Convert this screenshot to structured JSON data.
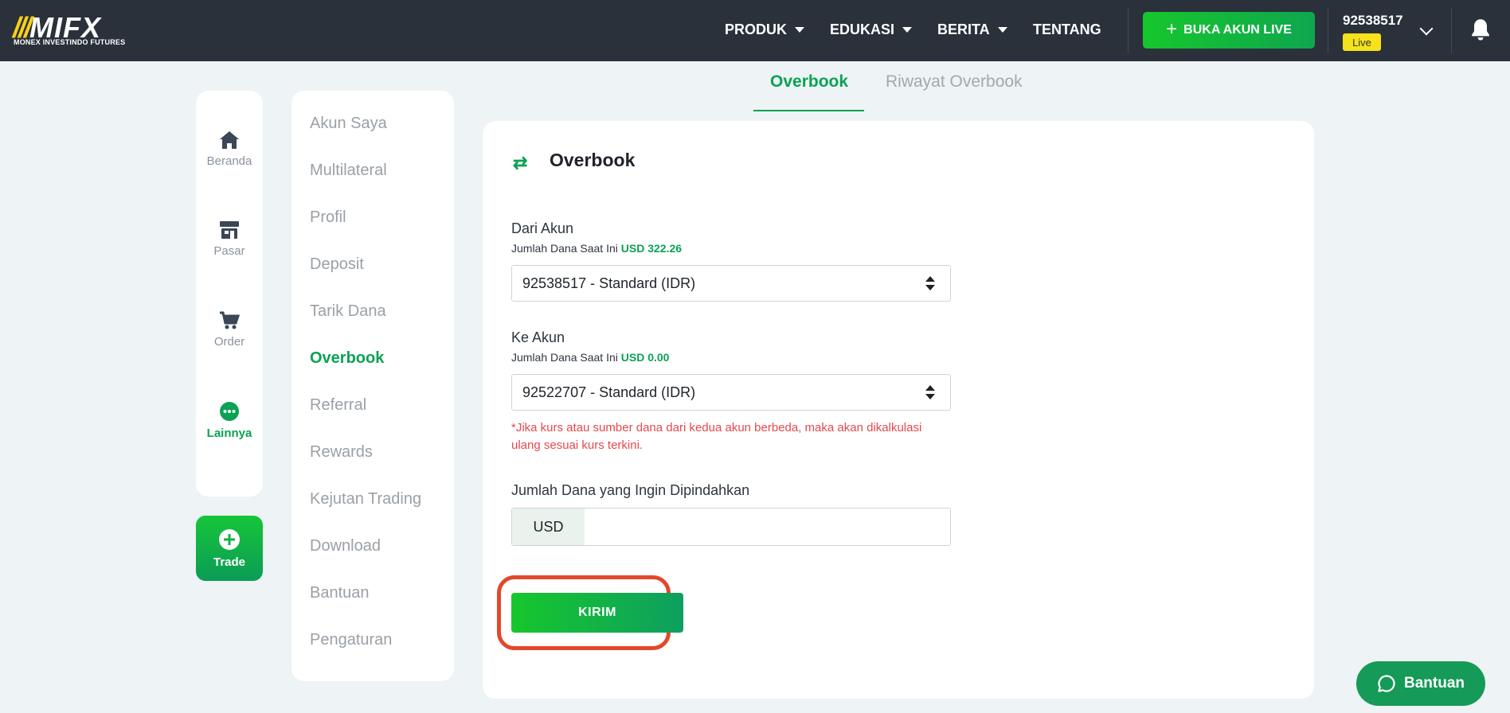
{
  "brand": {
    "logo_text": "MIFX",
    "tagline": "MONEX INVESTINDO FUTURES"
  },
  "nav": {
    "items": [
      {
        "label": "PRODUK",
        "has_dropdown": true
      },
      {
        "label": "EDUKASI",
        "has_dropdown": true
      },
      {
        "label": "BERITA",
        "has_dropdown": true
      },
      {
        "label": "TENTANG",
        "has_dropdown": false
      }
    ],
    "open_live_label": "BUKA AKUN LIVE",
    "account_number": "92538517",
    "account_badge": "Live"
  },
  "icon_sidebar": {
    "items": [
      {
        "label": "Beranda",
        "icon": "home-icon"
      },
      {
        "label": "Pasar",
        "icon": "store-icon"
      },
      {
        "label": "Order",
        "icon": "cart-icon"
      },
      {
        "label": "Lainnya",
        "icon": "more-icon",
        "active": true
      }
    ],
    "trade_label": "Trade"
  },
  "menu": {
    "items": [
      {
        "label": "Akun Saya"
      },
      {
        "label": "Multilateral"
      },
      {
        "label": "Profil"
      },
      {
        "label": "Deposit"
      },
      {
        "label": "Tarik Dana"
      },
      {
        "label": "Overbook",
        "active": true
      },
      {
        "label": "Referral"
      },
      {
        "label": "Rewards"
      },
      {
        "label": "Kejutan Trading"
      },
      {
        "label": "Download"
      },
      {
        "label": "Bantuan"
      },
      {
        "label": "Pengaturan"
      }
    ]
  },
  "tabs": [
    {
      "label": "Overbook",
      "active": true
    },
    {
      "label": "Riwayat Overbook",
      "active": false
    }
  ],
  "form": {
    "title": "Overbook",
    "from": {
      "label": "Dari Akun",
      "balance_prefix": "Jumlah Dana Saat Ini",
      "balance": "USD 322.26",
      "selected": "92538517 - Standard (IDR)"
    },
    "to": {
      "label": "Ke Akun",
      "balance_prefix": "Jumlah Dana Saat Ini",
      "balance": "USD 0.00",
      "selected": "92522707 - Standard (IDR)"
    },
    "warning_line1": "*Jika kurs atau sumber dana dari kedua akun berbeda, maka akan dikalkulasi",
    "warning_line2": "ulang sesuai kurs terkini.",
    "amount": {
      "label": "Jumlah Dana yang Ingin Dipindahkan",
      "currency": "USD",
      "value": ""
    },
    "submit_label": "KIRIM"
  },
  "help": {
    "label": "Bantuan"
  },
  "colors": {
    "navbar_bg": "#2a313b",
    "accent_green": "#0aa254",
    "background": "#eef3f5",
    "warning_red": "#e5484d",
    "highlight": "#e2482c",
    "badge_yellow": "#f6e21a"
  }
}
